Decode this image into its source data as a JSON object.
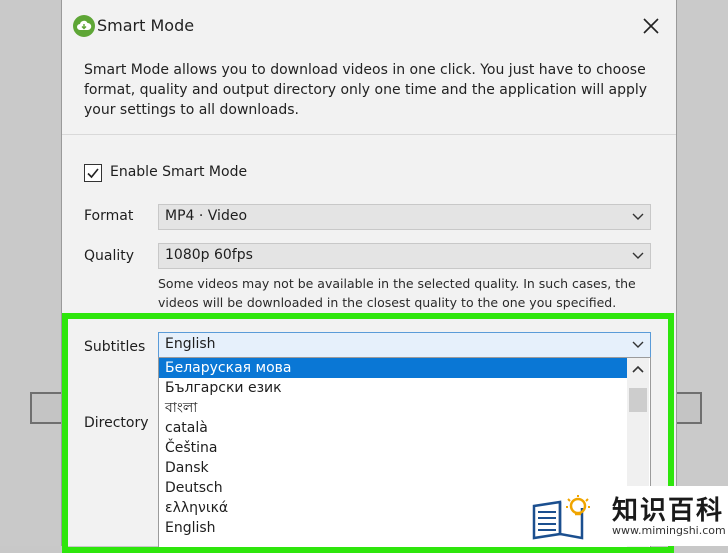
{
  "dialog": {
    "title": "Smart Mode",
    "description": "Smart Mode allows you to download videos in one click. You just have to choose format, quality and output directory only one time and the application will apply your settings to all downloads.",
    "enable_label": "Enable Smart Mode",
    "enable_checked": true,
    "format_label": "Format",
    "format_value": "MP4 · Video",
    "quality_label": "Quality",
    "quality_value": "1080p 60fps",
    "quality_note": "Some videos may not be available in the selected quality. In such cases, the videos will be downloaded in the closest quality to the one you specified.",
    "subtitles_label": "Subtitles",
    "subtitles_value": "English",
    "directory_label": "Directory",
    "subtitle_options": [
      "Беларуская мова",
      "Български език",
      "বাংলা",
      "català",
      "Čeština",
      "Dansk",
      "Deutsch",
      "ελληνικά",
      "English"
    ],
    "selected_option_index": 0
  },
  "colors": {
    "app_icon": "#5ea636",
    "highlight": "#2ee60c",
    "selection": "#0a77d5"
  },
  "watermark": {
    "title": "知识百科",
    "url": "www.mimingshi.com"
  }
}
